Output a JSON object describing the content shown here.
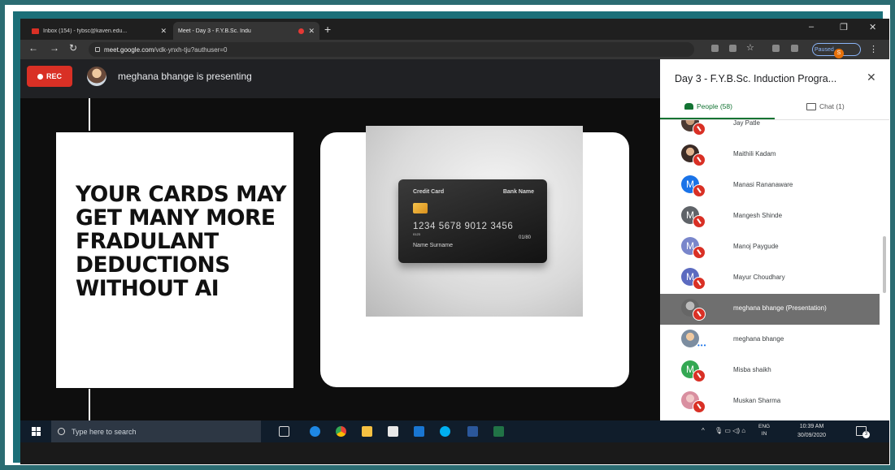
{
  "browser": {
    "tabs": [
      {
        "label": "Inbox (154) - fybsc@kaven.edu...",
        "icon": "gmail-icon",
        "active": false
      },
      {
        "label": "Meet - Day 3 - F.Y.B.Sc. Indu",
        "icon": "meet-icon",
        "active": true,
        "recording": true
      }
    ],
    "new_tab": "+",
    "url_prefix": "meet.google.com",
    "url_path": "/vdk-ynxh-tju?authuser=0",
    "profile_initial": "S",
    "profile_status": "Paused"
  },
  "meet": {
    "rec_label": "REC",
    "presenting_text": "meghana bhange is presenting",
    "slide": {
      "headline": "YOUR CARDS MAY GET MANY MORE FRADULANT DEDUCTIONS WITHOUT AI",
      "card": {
        "type_label": "Credit Card",
        "bank_label": "Bank Name",
        "number": "1234 5678 9012 3456",
        "sub_number": "0123",
        "expiry": "01/80",
        "holder": "Name Surname"
      }
    }
  },
  "panel": {
    "title": "Day 3 - F.Y.B.Sc. Induction Progra...",
    "tabs": {
      "people": "People (58)",
      "chat": "Chat (1)"
    },
    "participants": [
      {
        "name": "Jay Patle",
        "avatar": "photo",
        "muted": true
      },
      {
        "name": "Maithili Kadam",
        "avatar": "photo",
        "muted": true
      },
      {
        "name": "Manasi Rananaware",
        "initial": "M",
        "muted": true
      },
      {
        "name": "Mangesh Shinde",
        "initial": "M",
        "muted": true
      },
      {
        "name": "Manoj Paygude",
        "initial": "M",
        "muted": true
      },
      {
        "name": "Mayur Choudhary",
        "initial": "M",
        "muted": true
      },
      {
        "name": "meghana bhange (Presentation)",
        "avatar": "photo",
        "muted": true,
        "highlighted": true
      },
      {
        "name": "meghana bhange",
        "avatar": "photo",
        "muted": false,
        "speaking": true
      },
      {
        "name": "Misba shaikh",
        "initial": "M",
        "muted": true
      },
      {
        "name": "Muskan Sharma",
        "avatar": "photo",
        "muted": true
      }
    ]
  },
  "taskbar": {
    "search_placeholder": "Type here to search",
    "lang": [
      "ENG",
      "IN"
    ],
    "time": "10:39 AM",
    "date": "30/09/2020",
    "notification_count": "3"
  },
  "colors": {
    "frame": "#1b6f78",
    "rec": "#d93025",
    "people_tab": "#137333"
  }
}
